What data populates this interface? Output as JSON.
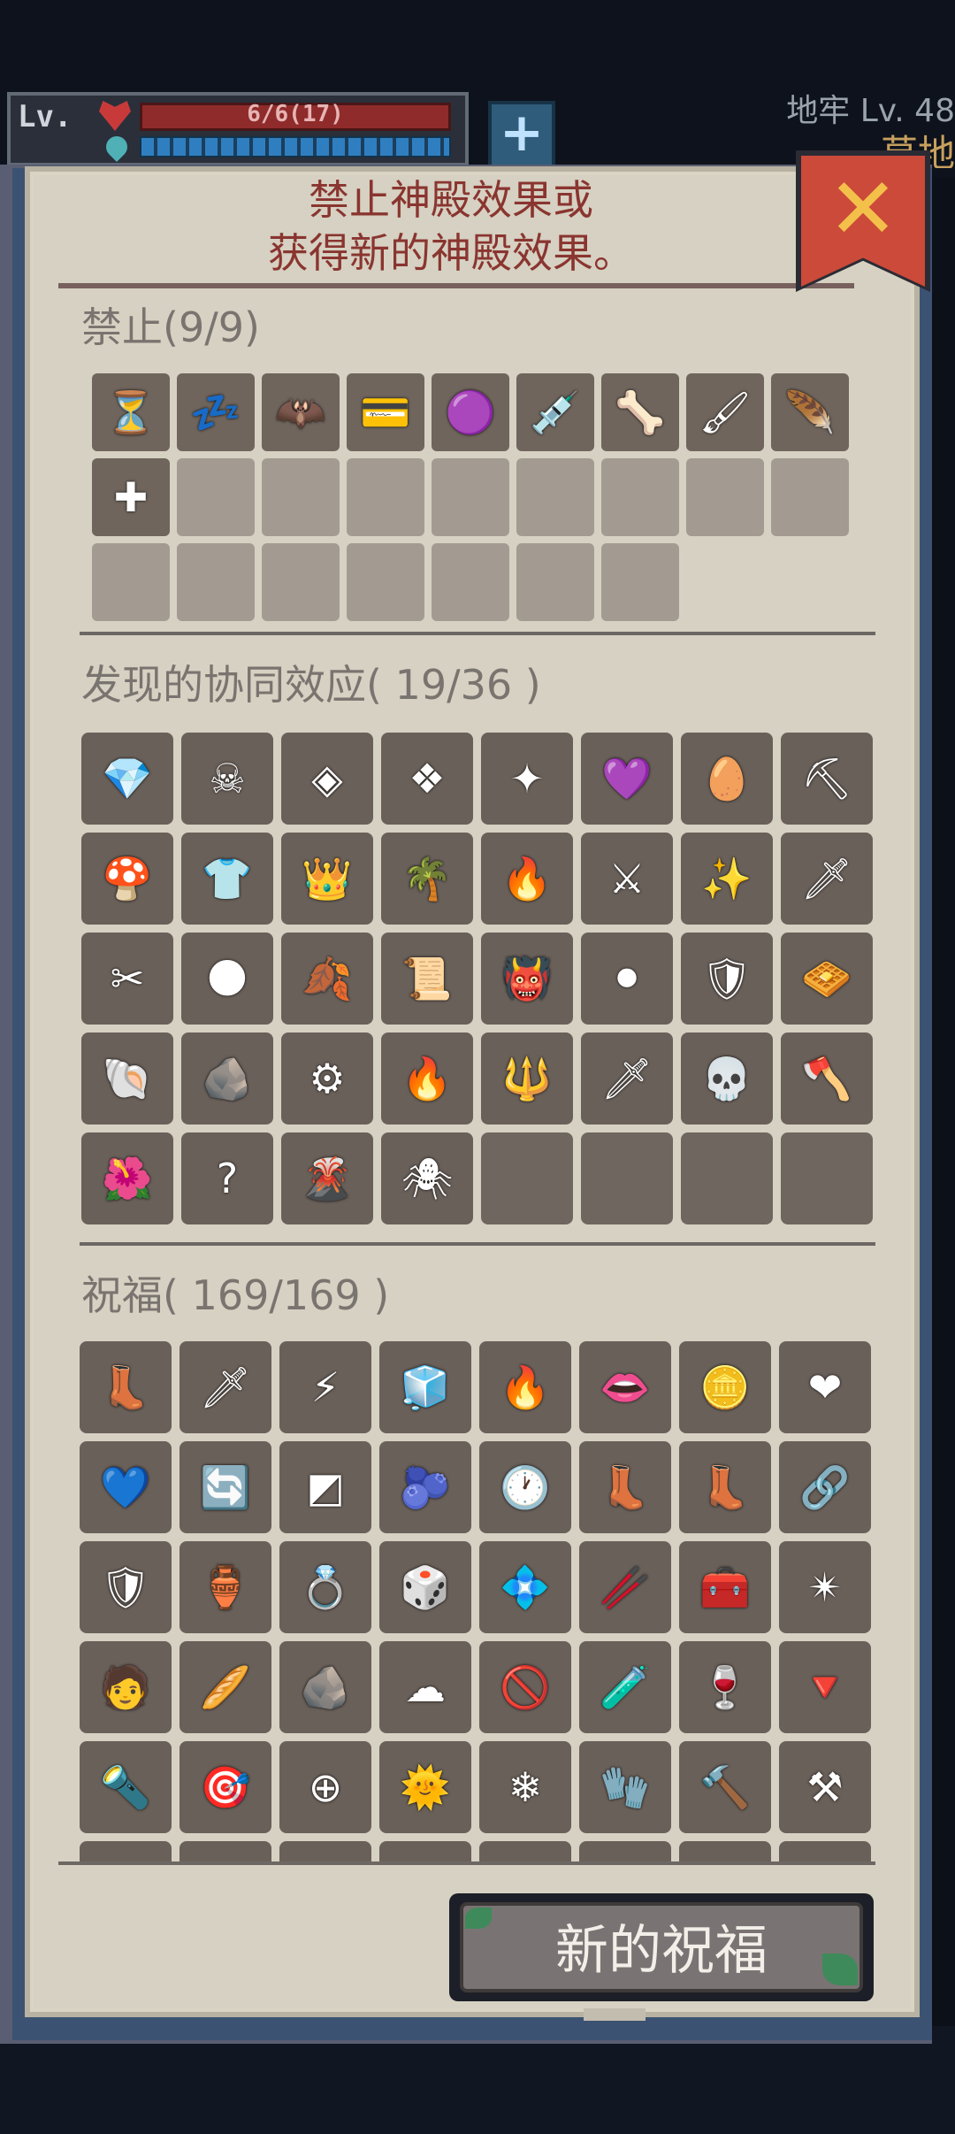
{
  "hud": {
    "level_label": "Lv.",
    "hp_text": "6/6(17)",
    "dungeon_label": "地牢 Lv. 48",
    "area_label": "草地"
  },
  "dialog": {
    "title_line1": "禁止神殿效果或",
    "title_line2": "获得新的神殿效果。",
    "ban_section_title": "禁止(9/9)",
    "synergy_section_title": "发现的协同效应( 19/36 )",
    "blessing_section_title": "祝福( 169/169 )",
    "new_blessing_button": "新的祝福"
  },
  "ban_icons": [
    "⏳",
    "💤",
    "🦇",
    "💳",
    "🟣",
    "💉",
    "🦴",
    "🖌",
    "🪶"
  ],
  "synergy_icons": [
    "💎",
    "☠",
    "◈",
    "❖",
    "✦",
    "💜",
    "🥚",
    "⛏",
    "🍄",
    "👕",
    "👑",
    "🌴",
    "🔥",
    "⚔",
    "✨",
    "🗡",
    "✂",
    "🌑",
    "🍂",
    "📜",
    "👹",
    "⚫",
    "🛡",
    "🧇",
    "🐚",
    "🪨",
    "⚙",
    "🔥",
    "🔱",
    "🗡",
    "💀",
    "🪓",
    "🌺",
    "?",
    "🌋",
    "🕷"
  ],
  "blessing_icons": [
    "👢",
    "🗡",
    "⚡",
    "🧊",
    "🔥",
    "👄",
    "🪙",
    "❤",
    "💙",
    "🔄",
    "◩",
    "🫐",
    "🕐",
    "👢",
    "👢",
    "🔗",
    "🛡",
    "🏺",
    "💍",
    "🎲",
    "💠",
    "🥢",
    "🧰",
    "✴",
    "🧑",
    "🥖",
    "🪨",
    "☁",
    "🚫",
    "🧪",
    "🍷",
    "🔻",
    "🔦",
    "🎯",
    "⊕",
    "🌞",
    "❄",
    "🧤",
    "🔨",
    "⚒"
  ],
  "colors": {
    "panel": "#d9d4c4",
    "title_text": "#8a3530",
    "section_text": "#7a7470",
    "close_flag": "#cc4a3a"
  }
}
